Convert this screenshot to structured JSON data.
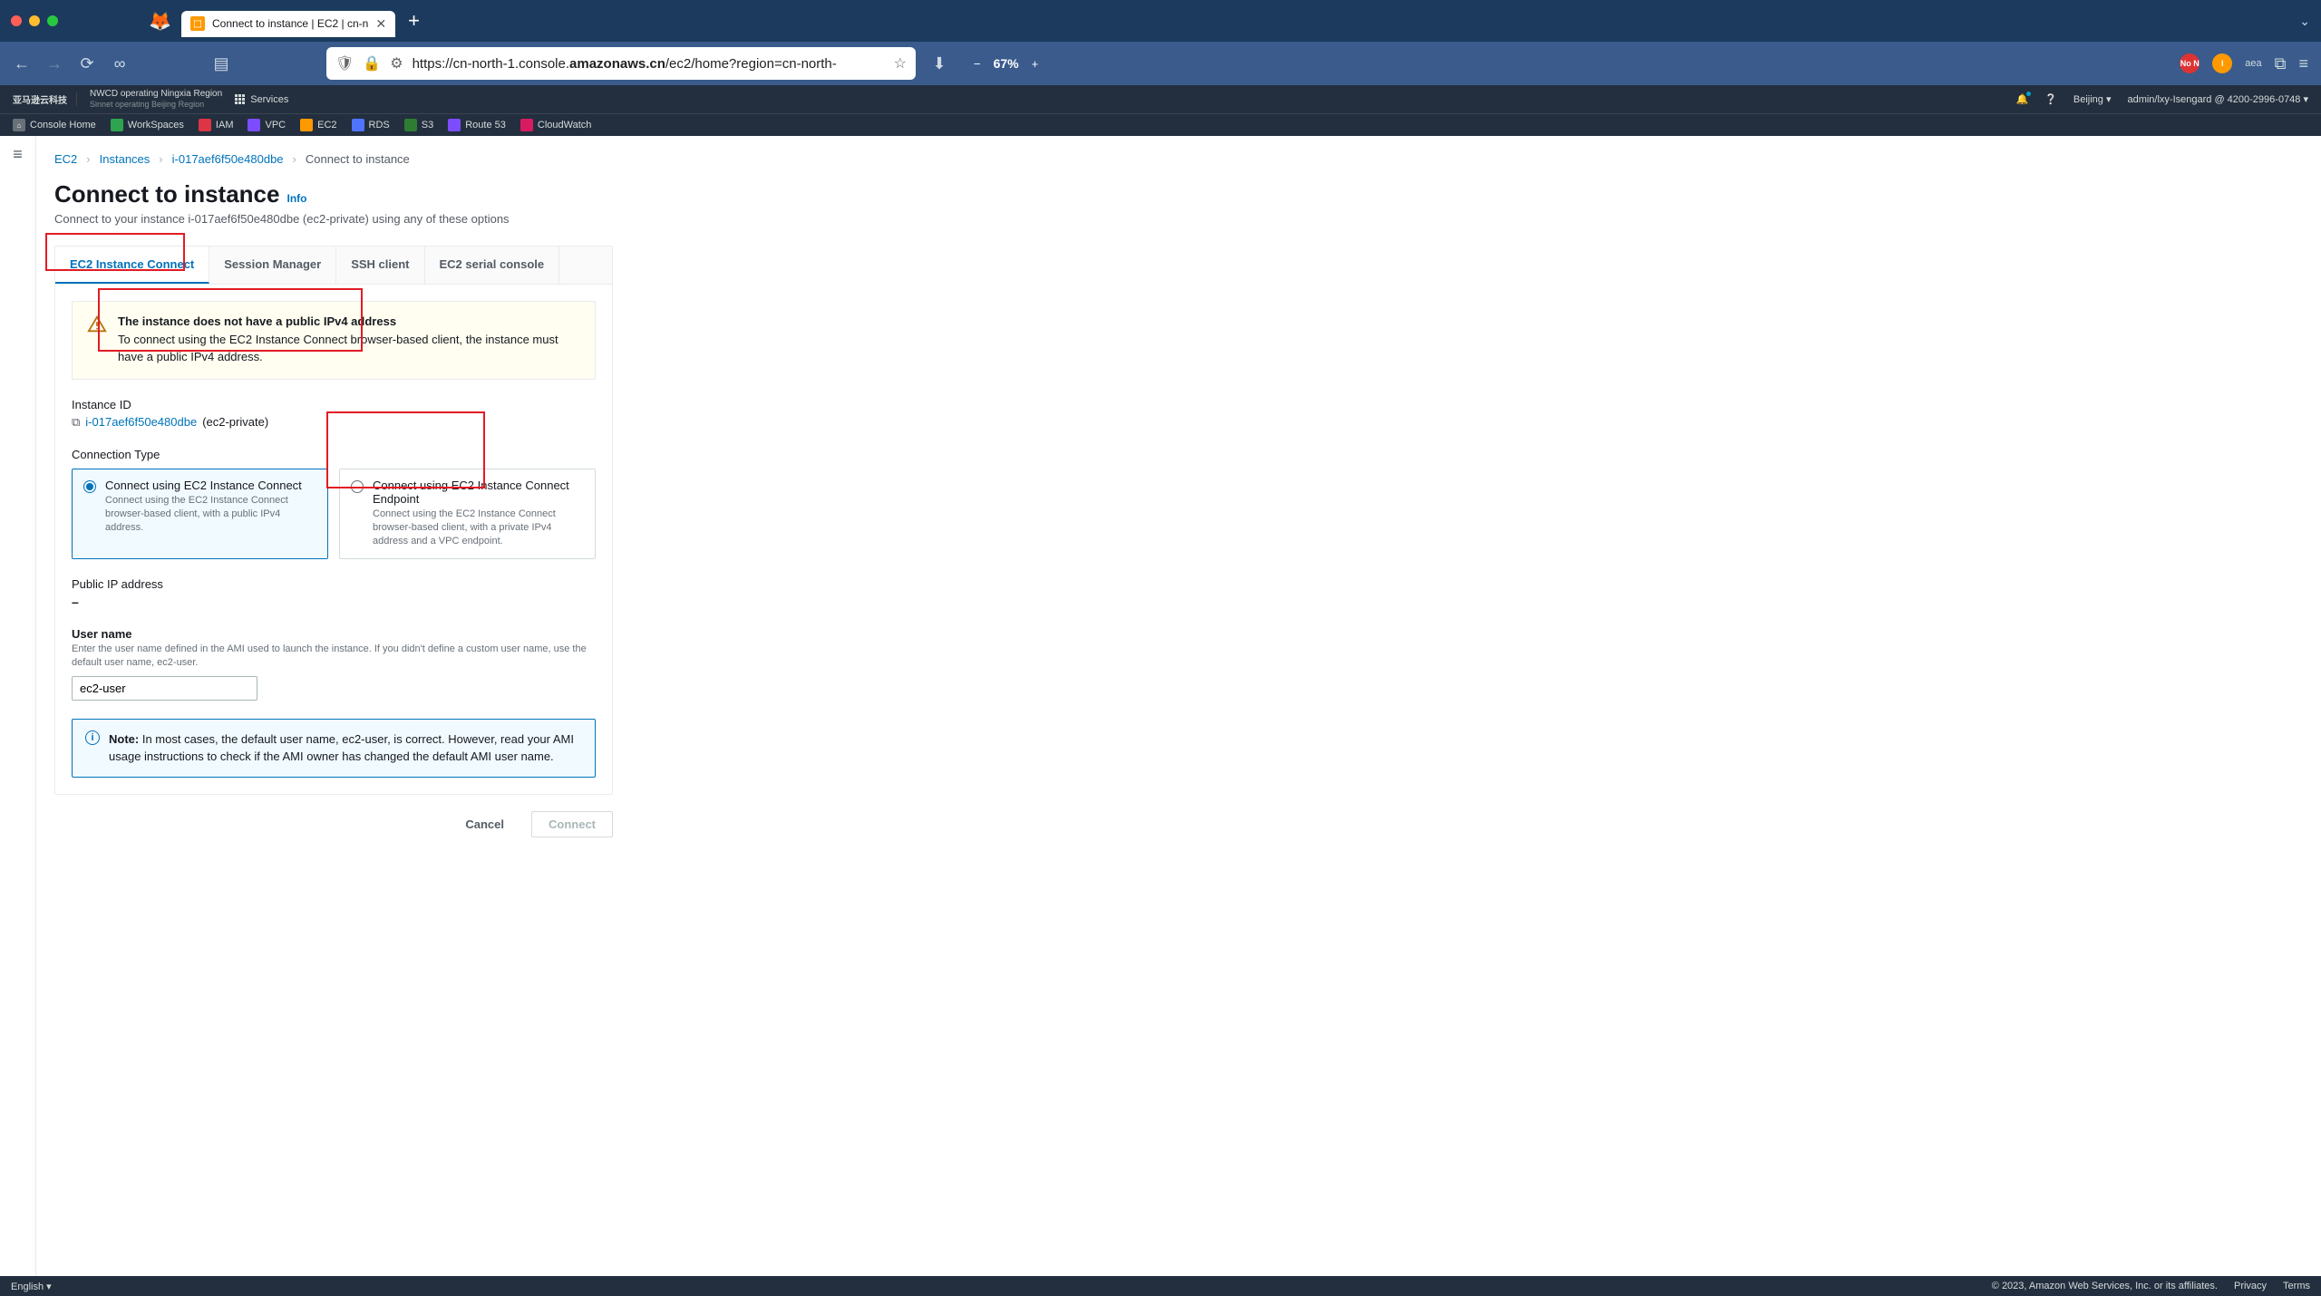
{
  "browser": {
    "tab_title": "Connect to instance | EC2 | cn-n",
    "url_prefix": "https://cn-north-1.console.",
    "url_bold": "amazonaws.cn",
    "url_suffix": "/ec2/home?region=cn-north-",
    "zoom": "67%"
  },
  "aws_nav": {
    "logo_cn": "亚马逊云科技",
    "nwcd_line": "NWCD operating Ningxia Region",
    "sinnet_line": "Sinnet operating Beijing Region",
    "services": "Services",
    "region": "Beijing",
    "user": "admin/lxy-Isengard @ 4200-2996-0748"
  },
  "subnav": [
    {
      "label": "Console Home",
      "color": "#687078"
    },
    {
      "label": "WorkSpaces",
      "color": "#2ea44f"
    },
    {
      "label": "IAM",
      "color": "#dc3545"
    },
    {
      "label": "VPC",
      "color": "#7c4dff"
    },
    {
      "label": "EC2",
      "color": "#ff9900"
    },
    {
      "label": "RDS",
      "color": "#4f74ff"
    },
    {
      "label": "S3",
      "color": "#2e7d32"
    },
    {
      "label": "Route 53",
      "color": "#7c4dff"
    },
    {
      "label": "CloudWatch",
      "color": "#d81b60"
    }
  ],
  "breadcrumb": {
    "0": "EC2",
    "1": "Instances",
    "2": "i-017aef6f50e480dbe",
    "3": "Connect to instance"
  },
  "page": {
    "title": "Connect to instance",
    "info": "Info",
    "subtitle": "Connect to your instance i-017aef6f50e480dbe (ec2-private) using any of these options"
  },
  "tabs": {
    "0": "EC2 Instance Connect",
    "1": "Session Manager",
    "2": "SSH client",
    "3": "EC2 serial console"
  },
  "warning": {
    "title": "The instance does not have a public IPv4 address",
    "body": "To connect using the EC2 Instance Connect browser-based client, the instance must have a public IPv4 address."
  },
  "instance": {
    "label": "Instance ID",
    "id": "i-017aef6f50e480dbe",
    "name_suffix": " (ec2-private)"
  },
  "connection_type": {
    "label": "Connection Type",
    "opt1_title": "Connect using EC2 Instance Connect",
    "opt1_desc": "Connect using the EC2 Instance Connect browser-based client, with a public IPv4 address.",
    "opt2_title": "Connect using EC2 Instance Connect Endpoint",
    "opt2_desc": "Connect using the EC2 Instance Connect browser-based client, with a private IPv4 address and a VPC endpoint."
  },
  "public_ip": {
    "label": "Public IP address",
    "value": "–"
  },
  "user": {
    "label": "User name",
    "help": "Enter the user name defined in the AMI used to launch the instance. If you didn't define a custom user name, use the default user name, ec2-user.",
    "value": "ec2-user"
  },
  "note": {
    "prefix": "Note:",
    "body": " In most cases, the default user name, ec2-user, is correct. However, read your AMI usage instructions to check if the AMI owner has changed the default AMI user name."
  },
  "actions": {
    "cancel": "Cancel",
    "connect": "Connect"
  },
  "footer": {
    "lang": "English",
    "copyright": "© 2023, Amazon Web Services, Inc. or its affiliates.",
    "privacy": "Privacy",
    "terms": "Terms"
  }
}
